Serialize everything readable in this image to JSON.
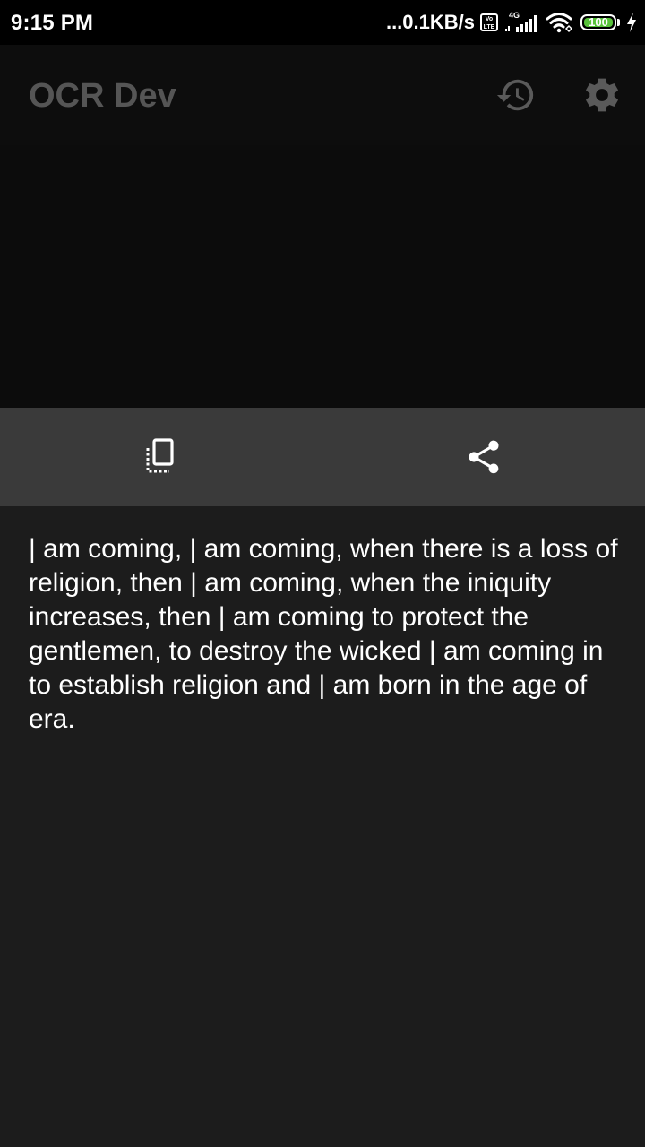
{
  "status_bar": {
    "time": "9:15 PM",
    "network_speed": "...0.1KB/s",
    "volte_label": "Vo LTE",
    "network_type": "4G",
    "battery_level": 100,
    "battery_label": "100",
    "charging": true
  },
  "app_bar": {
    "title": "OCR Dev",
    "actions": [
      {
        "icon": "history-icon"
      },
      {
        "icon": "gear-icon"
      }
    ]
  },
  "toolbar": {
    "actions": [
      {
        "icon": "copy-icon"
      },
      {
        "icon": "share-icon"
      }
    ]
  },
  "result": {
    "text": "| am coming, | am coming, when there is a loss of religion, then | am coming, when the iniquity increases, then | am coming to protect the gentlemen, to destroy the wicked | am coming in to establish religion and | am born in the age of era."
  },
  "colors": {
    "status_bar_bg": "#000000",
    "app_bar_bg": "#0d0d0d",
    "app_title": "#555555",
    "toolbar_bg": "#3a3a3a",
    "content_bg": "#1c1c1c",
    "text": "#ffffff",
    "battery_fill": "#58c23a"
  }
}
